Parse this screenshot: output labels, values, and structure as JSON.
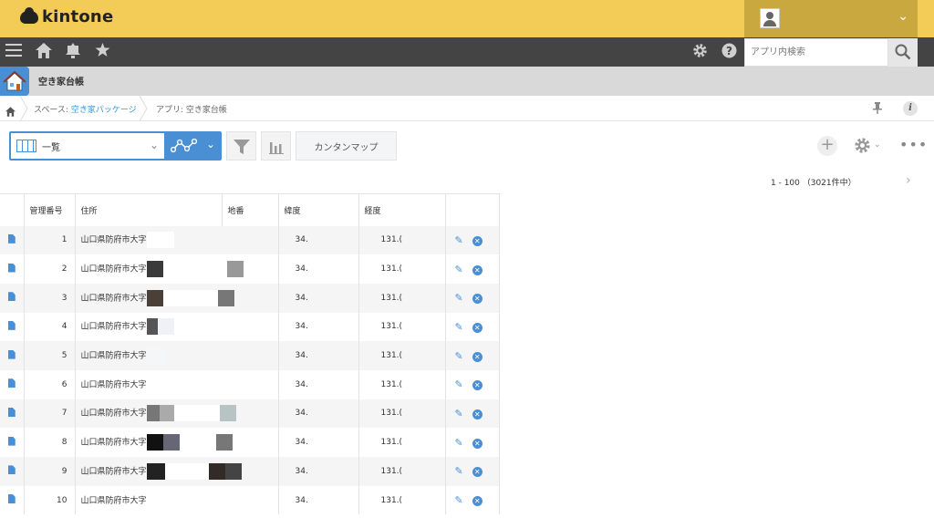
{
  "header": {
    "logo_text": "kintone",
    "search_placeholder": "アプリ内検索"
  },
  "app": {
    "title": "空き家台帳"
  },
  "breadcrumb": {
    "space_prefix": "スペース: ",
    "space_name": "空き家パッケージ",
    "app_prefix": "アプリ: ",
    "app_name": "空き家台帳"
  },
  "toolbar": {
    "view_label": "一覧",
    "map_button": "カンタンマップ",
    "pager": "1 - 100 （3021件中）"
  },
  "table": {
    "columns": {
      "id": "管理番号",
      "address": "住所",
      "lot": "地番",
      "latitude": "緯度",
      "longitude": "経度"
    },
    "rows": [
      {
        "id": "1",
        "address": "山口県防府市大字",
        "lat": "34.",
        "lng": "131.("
      },
      {
        "id": "2",
        "address": "山口県防府市大字",
        "lat": "34.",
        "lng": "131.("
      },
      {
        "id": "3",
        "address": "山口県防府市大字",
        "lat": "34.",
        "lng": "131.("
      },
      {
        "id": "4",
        "address": "山口県防府市大字",
        "lat": "34.",
        "lng": "131.("
      },
      {
        "id": "5",
        "address": "山口県防府市大字",
        "lat": "34.",
        "lng": "131.("
      },
      {
        "id": "6",
        "address": "山口県防府市大字",
        "lat": "34.",
        "lng": "131.("
      },
      {
        "id": "7",
        "address": "山口県防府市大字",
        "lat": "34.",
        "lng": "131.("
      },
      {
        "id": "8",
        "address": "山口県防府市大字",
        "lat": "34.",
        "lng": "131.("
      },
      {
        "id": "9",
        "address": "山口県防府市大字",
        "lat": "34.",
        "lng": "131.("
      },
      {
        "id": "10",
        "address": "山口県防府市大字",
        "lat": "34.",
        "lng": "131.("
      }
    ]
  },
  "colors": {
    "header_yellow": "#f3cc58",
    "nav_dark": "#444444",
    "accent_blue": "#4a8fd4",
    "link_blue": "#3498db"
  }
}
